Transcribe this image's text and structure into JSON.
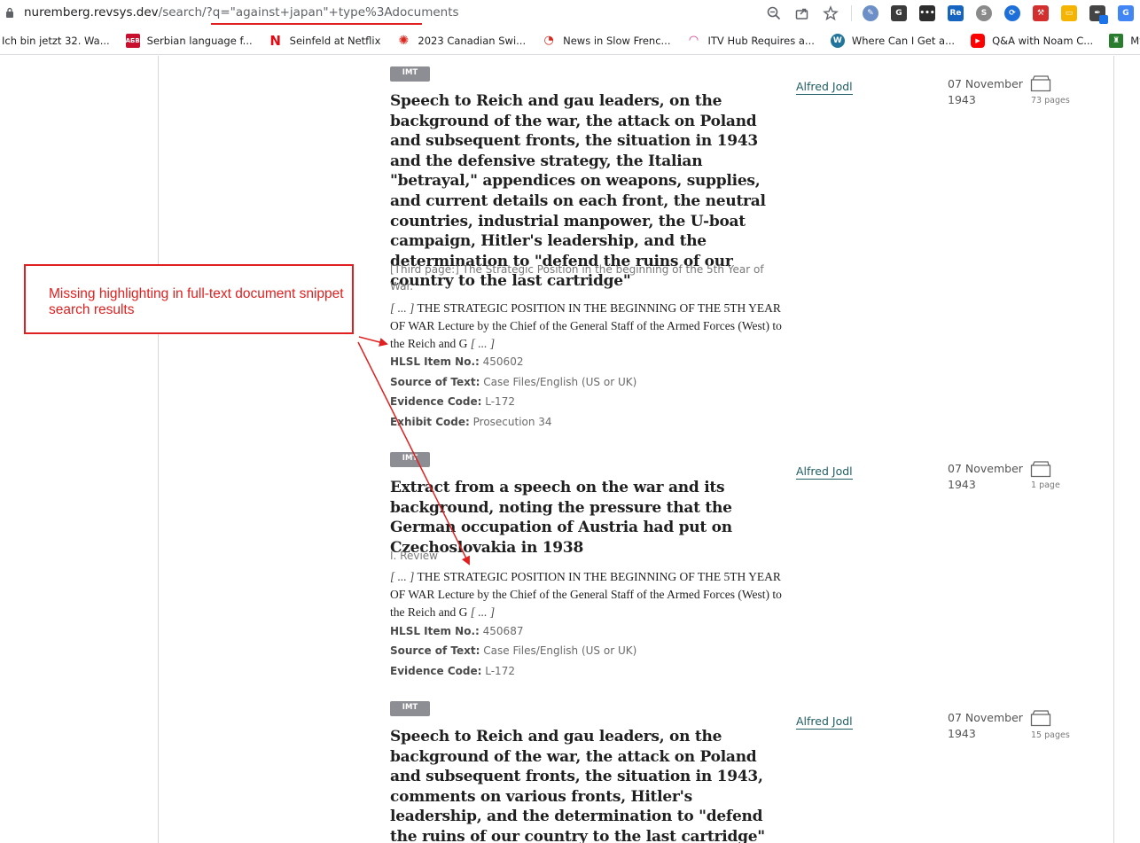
{
  "browser": {
    "url_host": "nuremberg.revsys.dev",
    "url_path": "/search/?q=\"against+japan\"+type%3Adocuments",
    "bookmarks": [
      {
        "label": "Ich bin jetzt 32. Wa...",
        "icon": "none"
      },
      {
        "label": "Serbian language f...",
        "icon": "abc-cyrillic-icon",
        "color": "#c8102e"
      },
      {
        "label": "Seinfeld at Netflix",
        "icon": "netflix-icon",
        "color": "#e50914"
      },
      {
        "label": "2023 Canadian Swi...",
        "icon": "cbc-icon",
        "color": "#d8281e"
      },
      {
        "label": "News in Slow Frenc...",
        "icon": "podcast-icon",
        "color": "#d8281e"
      },
      {
        "label": "ITV Hub Requires a...",
        "icon": "wifi-icon",
        "color": "#e0338a"
      },
      {
        "label": "Where Can I Get a...",
        "icon": "wordpress-icon",
        "color": "#21759b"
      },
      {
        "label": "Q&A with Noam C...",
        "icon": "youtube-icon",
        "color": "#ff0000"
      },
      {
        "label": "MyIntroduction",
        "icon": "crest-icon",
        "color": "#2a7d2e"
      }
    ]
  },
  "results": [
    {
      "badge": "IMT",
      "title": "Speech to Reich and gau leaders, on the background of the war, the attack on Poland and subsequent fronts, the situation in 1943 and the defensive strategy, the Italian \"betrayal,\" appendices on weapons, supplies, and current details on each front, the neutral countries, industrial manpower, the U-boat campaign, Hitler's leadership, and the determination to \"defend the ruins of our country to the last cartridge\"",
      "subtitle": "[Third page:] The Strategic Position in the beginning of the 5th Year of War.",
      "snippet_open": "[ ... ]",
      "snippet": " THE STRATEGIC POSITION IN THE BEGINNING OF THE 5TH YEAR OF WAR Lecture by the Chief of the General Staff of the Armed Forces (West) to the Reich and G ",
      "snippet_close": "[ ... ]",
      "fields": [
        {
          "key": "HLSL Item No.:",
          "value": "450602"
        },
        {
          "key": "Source of Text:",
          "value": "Case Files/English (US or UK)"
        },
        {
          "key": "Evidence Code:",
          "value": "L-172"
        },
        {
          "key": "Exhibit Code:",
          "value": "Prosecution 34"
        }
      ],
      "author": "Alfred Jodl",
      "date": "07 November 1943",
      "pages": "73 pages"
    },
    {
      "badge": "IMT",
      "title": "Extract from a speech on the war and its background, noting the pressure that the German occupation of Austria had put on Czechoslovakia in 1938",
      "subtitle": "I. Review",
      "snippet_open": "[ ... ]",
      "snippet": " THE STRATEGIC POSITION IN THE BEGINNING OF THE 5TH YEAR OF WAR Lecture by the Chief of the General Staff of the Armed Forces (West) to the Reich and G ",
      "snippet_close": "[ ... ]",
      "fields": [
        {
          "key": "HLSL Item No.:",
          "value": "450687"
        },
        {
          "key": "Source of Text:",
          "value": "Case Files/English (US or UK)"
        },
        {
          "key": "Evidence Code:",
          "value": "L-172"
        }
      ],
      "author": "Alfred Jodl",
      "date": "07 November 1943",
      "pages": "1 page"
    },
    {
      "badge": "IMT",
      "title": "Speech to Reich and gau leaders, on the background of the war, the attack on Poland and subsequent fronts, the situation in 1943, comments on various fronts, Hitler's leadership, and the determination to \"defend the ruins of our country to the last cartridge\" (abridged)",
      "author": "Alfred Jodl",
      "date": "07 November 1943",
      "pages": "15 pages"
    }
  ],
  "annotation": {
    "text": "Missing highlighting in full-text document snippet search results",
    "color": "#e02020"
  }
}
